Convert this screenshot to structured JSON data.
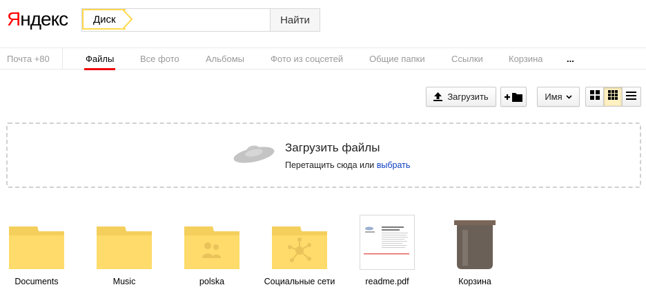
{
  "header": {
    "logo_first": "Я",
    "logo_rest": "ндекс",
    "search_tag": "Диск",
    "search_value": "",
    "search_button": "Найти"
  },
  "tabs": {
    "mail": "Почта +80",
    "items": [
      {
        "label": "Файлы",
        "active": true
      },
      {
        "label": "Все фото"
      },
      {
        "label": "Альбомы"
      },
      {
        "label": "Фото из соцсетей"
      },
      {
        "label": "Общие папки"
      },
      {
        "label": "Ссылки"
      },
      {
        "label": "Корзина"
      }
    ],
    "more": "..."
  },
  "toolbar": {
    "upload_label": "Загрузить",
    "sort_label": "Имя",
    "view_mode": "icons"
  },
  "dropzone": {
    "title": "Загрузить файлы",
    "hint": "Перетащить сюда или",
    "link": "выбрать"
  },
  "files": [
    {
      "name": "Documents",
      "type": "folder"
    },
    {
      "name": "Music",
      "type": "folder"
    },
    {
      "name": "polska",
      "type": "shared-folder"
    },
    {
      "name": "Социальные сети",
      "type": "social-folder"
    },
    {
      "name": "readme.pdf",
      "type": "pdf"
    },
    {
      "name": "Корзина",
      "type": "trash"
    }
  ],
  "colors": {
    "accent_red": "#ee0000",
    "folder": "#fedb6a",
    "link": "#0a3cc0",
    "search_highlight": "#ffd84a"
  }
}
